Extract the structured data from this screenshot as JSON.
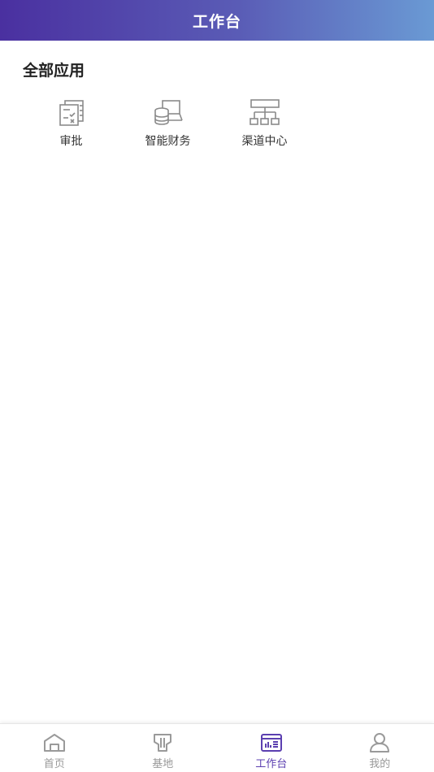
{
  "header": {
    "title": "工作台"
  },
  "section": {
    "title": "全部应用"
  },
  "apps": [
    {
      "label": "审批",
      "icon": "approval-icon"
    },
    {
      "label": "智能财务",
      "icon": "finance-database-icon"
    },
    {
      "label": "渠道中心",
      "icon": "channel-network-icon"
    }
  ],
  "tabbar": {
    "items": [
      {
        "label": "首页",
        "icon": "home-icon",
        "active": false
      },
      {
        "label": "基地",
        "icon": "base-icon",
        "active": false
      },
      {
        "label": "工作台",
        "icon": "workbench-icon",
        "active": true
      },
      {
        "label": "我的",
        "icon": "profile-icon",
        "active": false
      }
    ]
  },
  "colors": {
    "header_gradient_start": "#4a30a0",
    "header_gradient_end": "#6a9ad4",
    "active_tab": "#5b3fb0",
    "inactive_tab": "#999999"
  }
}
